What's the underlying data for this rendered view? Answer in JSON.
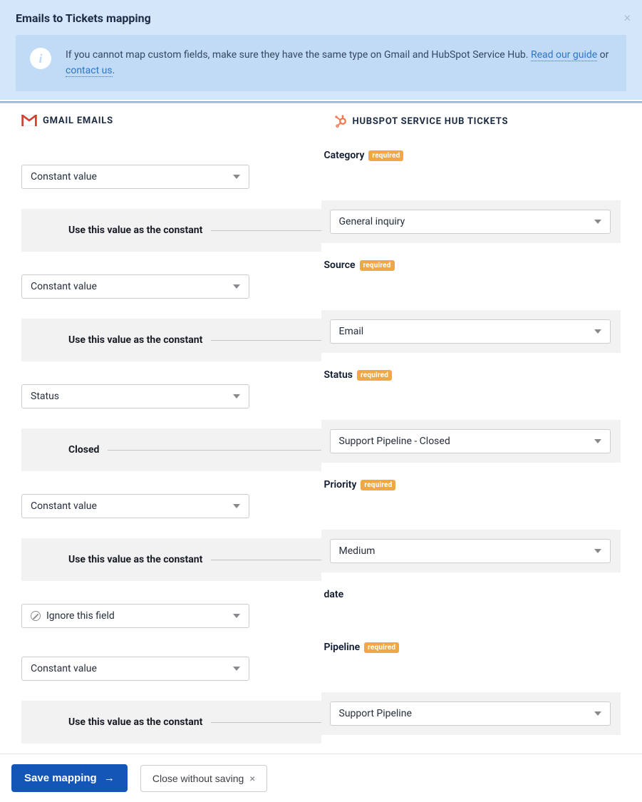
{
  "banner": {
    "title": "Emails to Tickets mapping",
    "info_prefix": "If you cannot map custom fields, make sure they have the same type on Gmail and HubSpot Service Hub. ",
    "info_link1": "Read our guide",
    "info_mid": " or ",
    "info_link2": "contact us",
    "info_suffix": "."
  },
  "columns": {
    "left_header": "GMAIL EMAILS",
    "right_header": "HUBSPOT SERVICE HUB TICKETS"
  },
  "labels": {
    "constant_note": "Use this value as the constant",
    "required": "required"
  },
  "rows": [
    {
      "right_label": "Category",
      "right_required": true,
      "left_select": "Constant value",
      "left_sub_kind": "constant",
      "left_sub_text": "Use this value as the constant",
      "right_select": "General inquiry"
    },
    {
      "right_label": "Source",
      "right_required": true,
      "left_select": "Constant value",
      "left_sub_kind": "constant",
      "left_sub_text": "Use this value as the constant",
      "right_select": "Email"
    },
    {
      "right_label": "Status",
      "right_required": true,
      "left_select": "Status",
      "left_sub_kind": "value",
      "left_sub_text": "Closed",
      "right_select": "Support Pipeline - Closed"
    },
    {
      "right_label": "Priority",
      "right_required": true,
      "left_select": "Constant value",
      "left_sub_kind": "constant",
      "left_sub_text": "Use this value as the constant",
      "right_select": "Medium"
    },
    {
      "right_label": "date",
      "right_required": false,
      "left_select": "Ignore this field",
      "left_icon": "ignore",
      "left_sub_kind": "none"
    },
    {
      "right_label": "Pipeline",
      "right_required": true,
      "left_select": "Constant value",
      "left_sub_kind": "constant",
      "left_sub_text": "Use this value as the constant",
      "right_select": "Support Pipeline"
    }
  ],
  "footer": {
    "save": "Save mapping",
    "close": "Close without saving"
  }
}
